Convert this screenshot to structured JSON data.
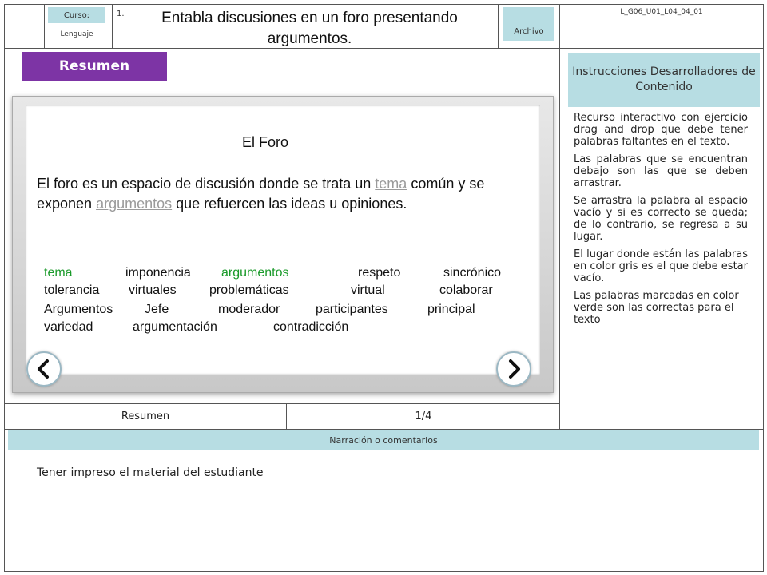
{
  "header": {
    "course_label": "Curso:",
    "subject": "Lenguaje",
    "number": "1.",
    "title": "Entabla discusiones en un foro presentando argumentos.",
    "archivo_label": "Archivo",
    "code": "L_G06_U01_L04_04_01"
  },
  "section": {
    "tab_label": "Resumen"
  },
  "slide": {
    "title": "El Foro",
    "text_before": "El foro es un espacio de discusión donde se trata un ",
    "blank_1": "tema",
    "text_middle": " común y se exponen ",
    "blank_2": "argumentos",
    "text_after": " que refuercen las ideas u opiniones.",
    "words": [
      {
        "text": "tema",
        "correct": true
      },
      {
        "text": "imponencia",
        "correct": false
      },
      {
        "text": "argumentos",
        "correct": true
      },
      {
        "text": "respeto",
        "correct": false
      },
      {
        "text": "sincrónico",
        "correct": false
      },
      {
        "text": "tolerancia",
        "correct": false
      },
      {
        "text": "virtuales",
        "correct": false
      },
      {
        "text": "problemáticas",
        "correct": false
      },
      {
        "text": "virtual",
        "correct": false
      },
      {
        "text": "colaborar",
        "correct": false
      },
      {
        "text": "Argumentos",
        "correct": false
      },
      {
        "text": "Jefe",
        "correct": false
      },
      {
        "text": "moderador",
        "correct": false
      },
      {
        "text": "participantes",
        "correct": false
      },
      {
        "text": "principal",
        "correct": false
      },
      {
        "text": "variedad",
        "correct": false
      },
      {
        "text": "argumentación",
        "correct": false
      },
      {
        "text": "contradicción",
        "correct": false
      }
    ],
    "prev_icon": "chevron-left-icon",
    "next_icon": "chevron-right-icon"
  },
  "footer": {
    "section_name": "Resumen",
    "page": "1/4"
  },
  "instructions": {
    "heading": "Instrucciones Desarrolladores de Contenido",
    "paragraphs": [
      "Recurso interactivo con ejercicio drag and drop que debe tener palabras faltantes en el texto.",
      "Las palabras que se encuentran debajo son las que se deben arrastrar.",
      "Se arrastra la palabra al espacio vacío y si es correcto se queda; de lo contrario, se regresa a su lugar.",
      "El lugar donde están las palabras en color gris es el que debe estar vacío.",
      "Las palabras marcadas en color verde son las correctas para el texto"
    ]
  },
  "narration": {
    "heading": "Narración o comentarios",
    "text": "Tener impreso el material del estudiante"
  },
  "colors": {
    "accent_purple": "#7d34a5",
    "header_blue": "#b7dde3",
    "correct_green": "#1a9a2a",
    "blank_gray": "#9a9a9a"
  }
}
